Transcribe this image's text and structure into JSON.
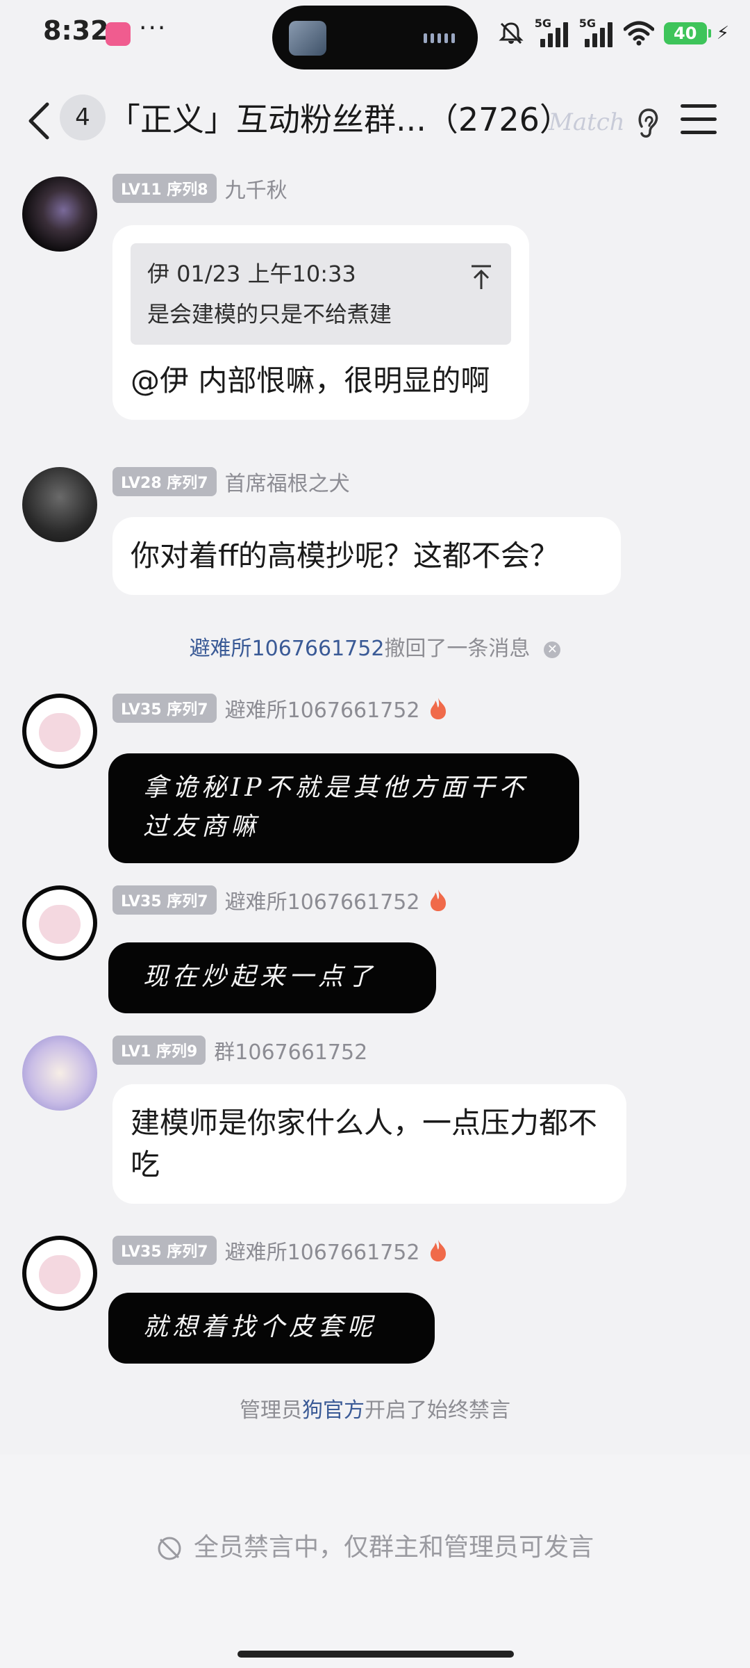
{
  "status_bar": {
    "time": "8:32",
    "dots": "···",
    "network1": "5G",
    "network2": "5G",
    "battery": "40"
  },
  "header": {
    "unread_count": "4",
    "title": "「正义」互动粉丝群...（2726）",
    "match_label": "Match"
  },
  "messages": [
    {
      "level": "LV11 序列8",
      "sender": "九千秋",
      "quote_head": "伊 01/23 上午10:33",
      "quote_text": "是会建模的只是不给煮建",
      "text": "@伊 内部恨嘛，很明显的啊"
    },
    {
      "level": "LV28 序列7",
      "sender": "首席福根之犬",
      "text": "你对着ff的高模抄呢？这都不会？"
    },
    {
      "level": "LV35 序列7",
      "sender": "避难所1067661752",
      "text": "拿诡秘IP不就是其他方面干不过友商嘛"
    },
    {
      "level": "LV35 序列7",
      "sender": "避难所1067661752",
      "text": "现在炒起来一点了"
    },
    {
      "level": "LV1 序列9",
      "sender": "群1067661752",
      "text": "建模师是你家什么人，一点压力都不吃"
    },
    {
      "level": "LV35 序列7",
      "sender": "避难所1067661752",
      "text": "就想着找个皮套呢"
    }
  ],
  "system": {
    "recall_user": "避难所1067661752",
    "recall_text": "撤回了一条消息",
    "ban_prefix": "管理员",
    "ban_admin": "狗官方",
    "ban_suffix": "开启了始终禁言"
  },
  "bottom": {
    "mute_notice": "全员禁言中，仅群主和管理员可发言"
  },
  "colors": {
    "background": "#f2f2f4",
    "link": "#3a5a96",
    "badge": "#b7b8bf",
    "battery": "#3ec45a"
  },
  "icons": [
    "back-icon",
    "ear-icon",
    "menu-icon",
    "pin-top-icon",
    "flame-icon",
    "close-icon",
    "mute-icon"
  ]
}
